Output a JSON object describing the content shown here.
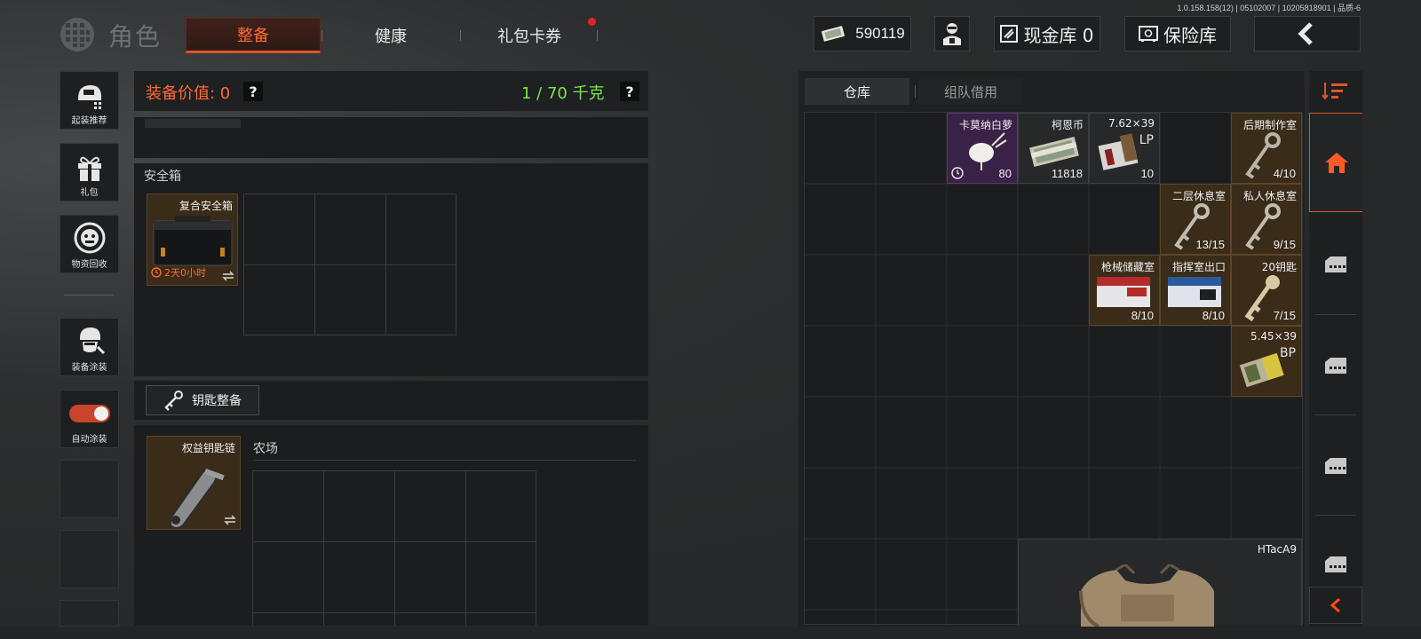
{
  "version": "1.0.158.158(12) | 05102007 | 10205818901 | 品质-6",
  "header": {
    "title": "角色",
    "tabs": [
      {
        "label": "整备",
        "active": true
      },
      {
        "label": "健康",
        "active": false
      },
      {
        "label": "礼包卡券",
        "active": false,
        "badge": true
      }
    ],
    "money": "590119",
    "cash_vault": "现金库 0",
    "insurance_vault": "保险库"
  },
  "sidebar": {
    "items": [
      {
        "label": "起装推荐",
        "icon": "helmet-icon"
      },
      {
        "label": "礼包",
        "icon": "gift-icon"
      },
      {
        "label": "物资回收",
        "icon": "recycle-icon"
      },
      {
        "label": "装备涂装",
        "icon": "soldier-icon"
      },
      {
        "label": "自动涂装",
        "icon": "toggle-icon"
      }
    ]
  },
  "loadout": {
    "value_label": "装备价值: 0",
    "weight_label": "1 / 70 千克",
    "help": "?",
    "safebox_section": "安全箱",
    "safebox_item": {
      "name": "复合安全箱",
      "timer": "2天0小时"
    },
    "key_button": "钥匙整备",
    "keychain_item": {
      "name": "权益钥匙链"
    },
    "farm_label": "农场"
  },
  "warehouse": {
    "tabs": [
      {
        "label": "仓库",
        "active": true
      },
      {
        "label": "组队借用",
        "active": false
      }
    ],
    "items": [
      {
        "name": "卡莫纳白萝",
        "count": "80",
        "rarity": "purple"
      },
      {
        "name": "柯恩币",
        "count": "11818",
        "rarity": "dark"
      },
      {
        "name": "7.62×39",
        "sub": "LP",
        "count": "10",
        "rarity": "dark"
      },
      {
        "name": "后期制作室",
        "count": "4/10",
        "rarity": "gold"
      },
      {
        "name": "二层休息室",
        "count": "13/15",
        "rarity": "gold"
      },
      {
        "name": "私人休息室",
        "count": "9/15",
        "rarity": "gold"
      },
      {
        "name": "枪械储藏室",
        "count": "8/10",
        "rarity": "gold"
      },
      {
        "name": "指挥室出口",
        "count": "8/10",
        "rarity": "gold"
      },
      {
        "name": "20钥匙",
        "count": "7/15",
        "rarity": "gold"
      },
      {
        "name": "5.45×39",
        "sub": "BP",
        "count": "",
        "rarity": "gold"
      },
      {
        "name": "HTacA9",
        "count": "",
        "rarity": "dark"
      }
    ]
  },
  "colors": {
    "accent": "#ff6a35",
    "weight_ok": "#7ee34a",
    "gold_bg": "#3a2c19",
    "purple_bg": "#3a2148"
  }
}
